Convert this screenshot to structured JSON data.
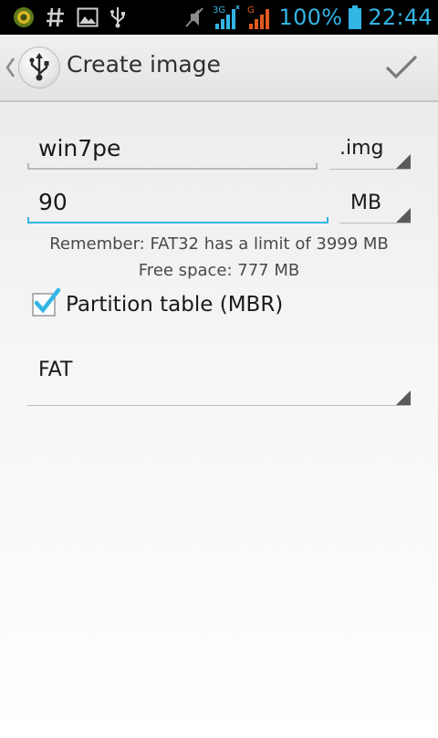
{
  "status_bar": {
    "network_3g": "3G",
    "network_g": "G",
    "battery": "100%",
    "time": "22:44",
    "icons": [
      "notification-app-icon",
      "hash-icon",
      "image-icon",
      "usb-icon",
      "mute-icon",
      "signal-3g-icon",
      "signal-g-icon",
      "battery-icon"
    ]
  },
  "action_bar": {
    "title": "Create image",
    "app_icon": "usb-icon",
    "done_icon": "checkmark-icon"
  },
  "form": {
    "filename_value": "win7pe",
    "extension_value": ".img",
    "size_value": "90",
    "unit_value": "MB",
    "fat_note": "Remember: FAT32 has a limit of 3999 MB",
    "free_space": "Free space: 777 MB",
    "partition_label": "Partition table (MBR)",
    "partition_checked": true,
    "filesystem_value": "FAT"
  },
  "colors": {
    "accent": "#33b5e5",
    "status_bg": "#000000",
    "actionbar_bg": "#e8e8e8"
  }
}
